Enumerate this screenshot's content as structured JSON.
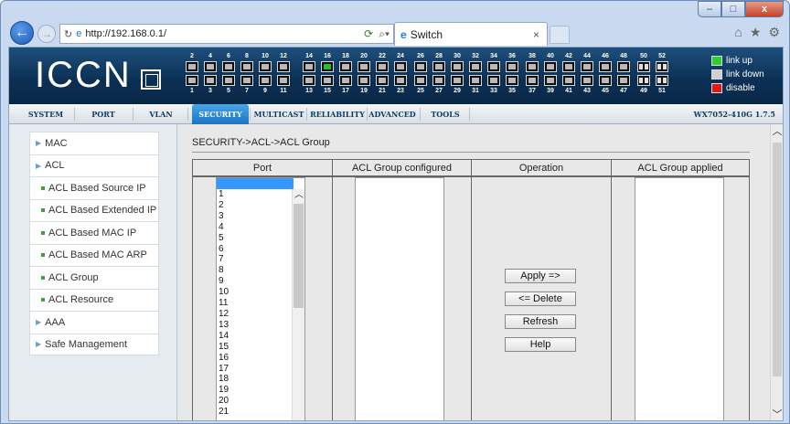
{
  "browser": {
    "url": "http://192.168.0.1/",
    "tab_title": "Switch",
    "tab_close": "×",
    "win_min": "–",
    "win_max": "□",
    "win_close": "x",
    "tools": [
      "⌂",
      "★",
      "⚙"
    ]
  },
  "device": {
    "logo": "ICCN",
    "ports_top": [
      "2",
      "4",
      "6",
      "8",
      "10",
      "12",
      "14",
      "16",
      "18",
      "20",
      "22",
      "24",
      "26",
      "28",
      "30",
      "32",
      "34",
      "36",
      "38",
      "40",
      "42",
      "44",
      "46",
      "48",
      "50",
      "52"
    ],
    "ports_bottom": [
      "1",
      "3",
      "5",
      "7",
      "9",
      "11",
      "13",
      "15",
      "17",
      "19",
      "21",
      "23",
      "25",
      "27",
      "29",
      "31",
      "33",
      "35",
      "37",
      "39",
      "41",
      "43",
      "45",
      "47",
      "49",
      "51"
    ],
    "port_up": "16",
    "legend": {
      "link_up": "link up",
      "link_down": "link down",
      "disable": "disable"
    },
    "colors": {
      "link_up": "#2bd02b",
      "link_down": "#d0d0d0",
      "disable": "#e01818"
    }
  },
  "menu": {
    "items": [
      "SYSTEM",
      "PORT",
      "VLAN",
      "SECURITY",
      "MULTICAST",
      "RELIABILITY",
      "ADVANCED",
      "TOOLS"
    ],
    "active": "SECURITY",
    "model": "WX7052-410G 1.7.5"
  },
  "sidebar": {
    "items": [
      {
        "label": "MAC",
        "type": "group"
      },
      {
        "label": "ACL",
        "type": "group"
      },
      {
        "label": "ACL Based Source IP",
        "type": "sub"
      },
      {
        "label": "ACL Based Extended IP",
        "type": "sub"
      },
      {
        "label": "ACL Based MAC IP",
        "type": "sub"
      },
      {
        "label": "ACL Based MAC ARP",
        "type": "sub"
      },
      {
        "label": "ACL Group",
        "type": "sub"
      },
      {
        "label": "ACL Resource",
        "type": "sub"
      },
      {
        "label": "AAA",
        "type": "group"
      },
      {
        "label": "Safe Management",
        "type": "group"
      }
    ]
  },
  "main": {
    "breadcrumb": "SECURITY->ACL->ACL Group",
    "columns": [
      "Port",
      "ACL Group configured",
      "Operation",
      "ACL Group applied"
    ],
    "port_list": [
      "1",
      "2",
      "3",
      "4",
      "5",
      "6",
      "7",
      "8",
      "9",
      "10",
      "11",
      "12",
      "13",
      "14",
      "15",
      "16",
      "17",
      "18",
      "19",
      "20",
      "21"
    ],
    "buttons": {
      "apply": "Apply =>",
      "delete": "<= Delete",
      "refresh": "Refresh",
      "help": "Help"
    }
  }
}
